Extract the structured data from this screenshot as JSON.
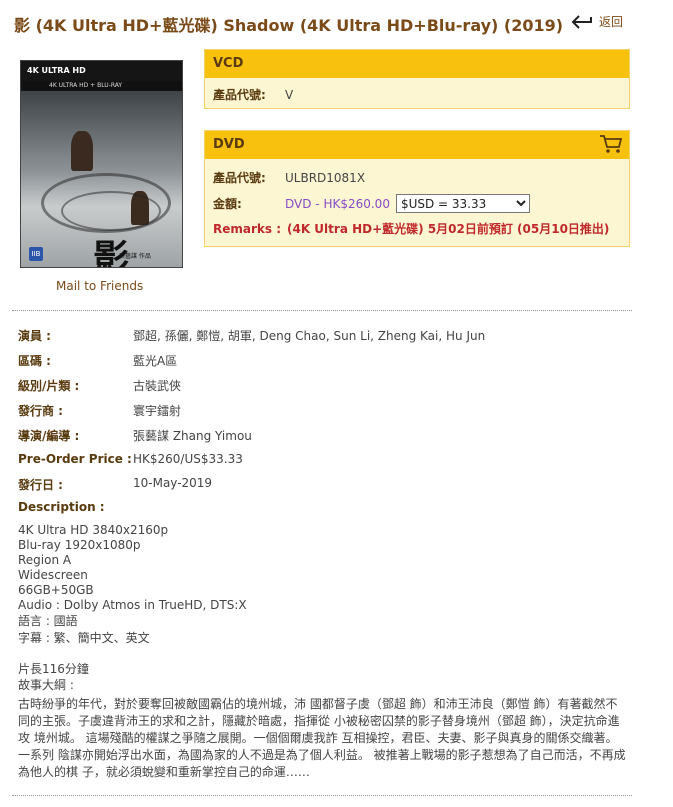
{
  "page": {
    "title": "影 (4K Ultra HD+藍光碟) Shadow (4K Ultra HD+Blu-ray) (2019)",
    "back_label": "返回",
    "mail_link": "Mail to Friends"
  },
  "cover": {
    "band_text": "4K ULTRA HD",
    "band2_text": "4K ULTRA HD + BLU-RAY",
    "glyph": "影",
    "sub_text": "張藝謀 作品",
    "rating": "IIB"
  },
  "vcd_panel": {
    "header": "VCD",
    "code_label": "產品代號:",
    "code_value": "V"
  },
  "dvd_panel": {
    "header": "DVD",
    "code_label": "產品代號:",
    "code_value": "ULBRD1081X",
    "amount_label": "金額:",
    "price": "DVD - HK$260.00",
    "currency_selected": "$USD = 33.33",
    "remarks_label": "Remarks :",
    "remarks_text": "(4K Ultra HD+藍光碟) 5月02日前預訂 (05月10日推出)"
  },
  "info": [
    {
      "key": "演員 :",
      "value": "鄧超, 孫儷, 鄭愷, 胡軍, Deng Chao, Sun Li, Zheng Kai, Hu Jun"
    },
    {
      "key": "區碼 :",
      "value": "藍光A區"
    },
    {
      "key": "級別/片類 :",
      "value": "古裝武俠"
    },
    {
      "key": "發行商 :",
      "value": "寰宇鐳射"
    },
    {
      "key": "導演/編導 :",
      "value": "張藝謀 Zhang Yimou"
    },
    {
      "key": "Pre-Order Price :",
      "value": "HK$260/US$33.33"
    },
    {
      "key": "發行日 :",
      "value": "10-May-2019"
    }
  ],
  "description": {
    "title": "Description :",
    "specs": [
      "4K Ultra HD 3840x2160p",
      "Blu-ray 1920x1080p",
      "Region A",
      "Widescreen",
      "66GB+50GB",
      "Audio : Dolby Atmos in TrueHD, DTS:X",
      "語言 : 國語",
      "字幕 : 繁、簡中文、英文"
    ],
    "runtime": "片長116分鐘",
    "story_label": "故事大綱 :",
    "story": "古時紛爭的年代，對於要奪回被敵國霸佔的境州城，沛 國都督子虞（鄧超 飾）和沛王沛良（鄭愷 飾）有著截然不 同的主張。子虞違背沛王的求和之計，隱藏於暗處，指揮從 小被秘密囚禁的影子替身境州（鄧超 飾），決定抗命進攻 境州城。 這場殘酷的權謀之爭隨之展開。一個個爾虞我詐 互相操控，君臣、夫妻、影子與真身的關係交織著。一系列 陰謀亦開始浮出水面，為國為家的人不過是為了個人利益。 被推著上戰場的影子惹想為了自己而活，不再成為他人的棋 子，就必須蛻變和重新掌控自己的命運……"
  },
  "colors": {
    "header_yellow": "#f8c10d",
    "panel_bg": "#fdf6d3",
    "title_brown": "#7a4a18",
    "price_purple": "#8a4bc7",
    "remarks_red": "#c0292c"
  }
}
